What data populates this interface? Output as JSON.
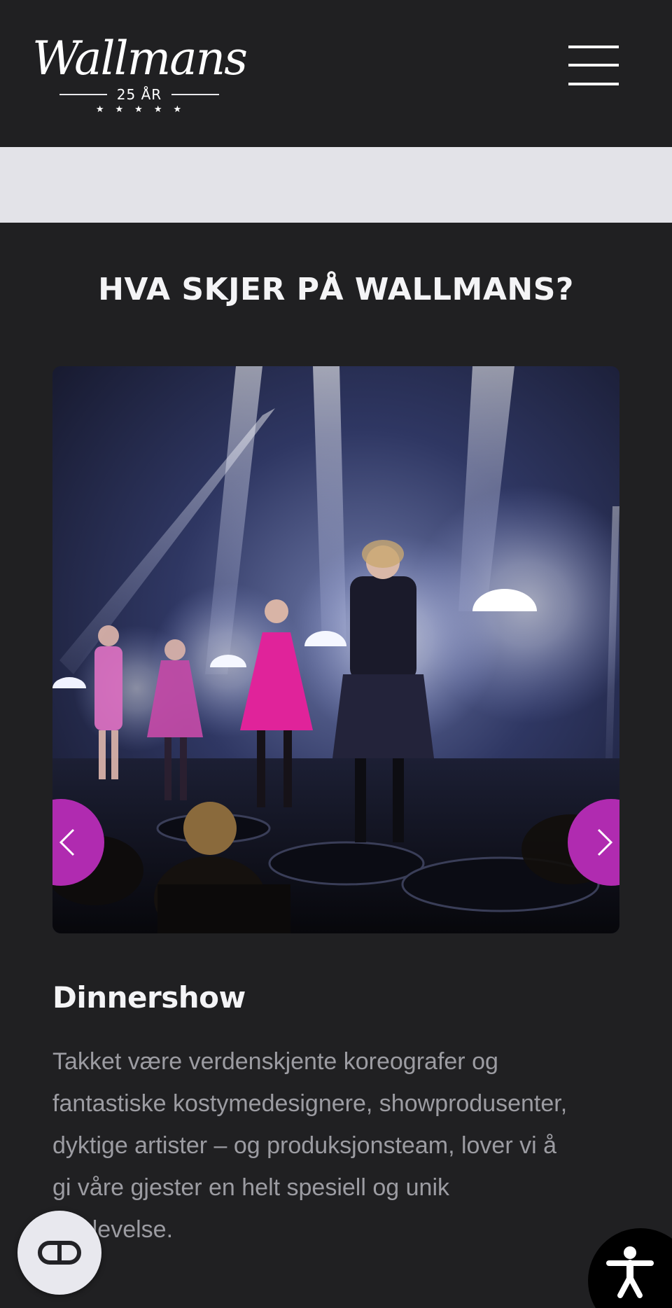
{
  "header": {
    "logo": {
      "wordmark": "Wallmans",
      "tagline": "25 ÅR",
      "stars": "★★★★★"
    },
    "menu_icon": "hamburger-menu-icon"
  },
  "section": {
    "title": "HVA SKJER PÅ WALLMANS?"
  },
  "carousel": {
    "prev_icon": "chevron-left-icon",
    "next_icon": "chevron-right-icon",
    "button_color": "#b02bb0"
  },
  "card": {
    "title": "Dinnershow",
    "text": "Takket være verdenskjente koreografer og fantastiske kostymedesignere, showprodusenter, dyktige artister – og produksjonsteam, lover vi å gi våre gjester en helt spesiell og unik opplevelse."
  },
  "floating": {
    "cookie_icon": "cookie-consent-icon",
    "accessibility_icon": "accessibility-icon"
  },
  "colors": {
    "background": "#202022",
    "band": "#e3e3e8",
    "accent": "#b02bb0",
    "heading": "#f4f4f6",
    "body_text": "#9c9ca2"
  }
}
